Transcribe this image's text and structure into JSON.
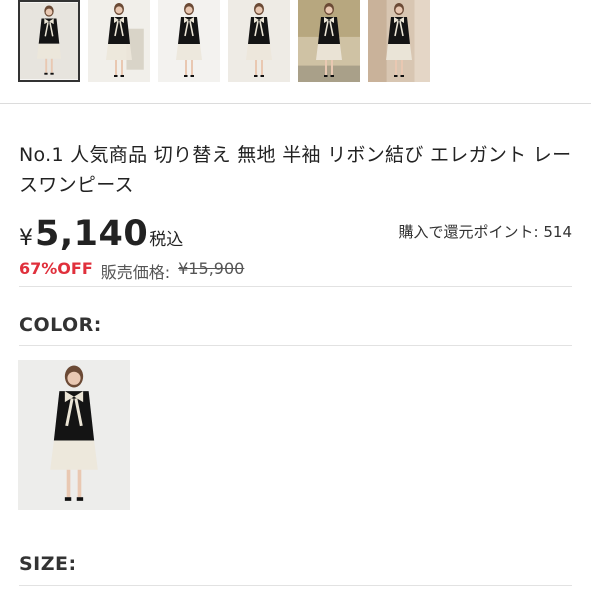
{
  "thumbnails": [
    {
      "selected": true,
      "bg": "#e7e4de",
      "scene": "studio"
    },
    {
      "selected": false,
      "bg": "#f1efea",
      "scene": "chair"
    },
    {
      "selected": false,
      "bg": "#f3f2ef",
      "scene": "studio"
    },
    {
      "selected": false,
      "bg": "#eeebe5",
      "scene": "studio"
    },
    {
      "selected": false,
      "bg": "#cfc2a4",
      "scene": "outdoor"
    },
    {
      "selected": false,
      "bg": "#d8c6b2",
      "scene": "room"
    }
  ],
  "product": {
    "title": "No.1 人気商品 切り替え 無地 半袖 リボン結び エレガント レースワンピース",
    "currency_symbol": "¥",
    "price": "5,140",
    "tax_label": "税込",
    "points_text": "購入で還元ポイント: 514",
    "discount": "67%OFF",
    "original_price_label": "販売価格:",
    "original_price": "¥15,900"
  },
  "sections": {
    "color_label": "COLOR:",
    "size_label": "SIZE:"
  },
  "colors": {
    "dress": "#141414",
    "lace": "#ece7da",
    "bow": "#ebe5d6",
    "skin": "#e9c8b2",
    "hair": "#6b4a35",
    "discount": "#e0303c"
  }
}
